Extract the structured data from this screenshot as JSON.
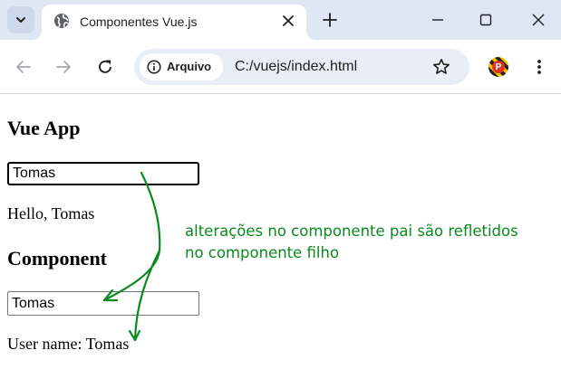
{
  "browser": {
    "tab": {
      "title": "Componentes Vue.js"
    },
    "address_bar": {
      "site_chip_label": "Arquivo",
      "url": "C:/vuejs/index.html"
    },
    "profile_initial": "P"
  },
  "page": {
    "app_heading": "Vue App",
    "parent_input_value": "Tomas",
    "hello_text": "Hello, Tomas",
    "component_heading": "Component",
    "child_input_value": "Tomas",
    "username_text": "User name: Tomas"
  },
  "annotation": {
    "line1": "alterações no componente pai são refletidos",
    "line2": "no componente filho",
    "color": "#0a8a1f"
  },
  "colors": {
    "tabstrip": "#dfe7f5",
    "omnibox": "#e9eef6"
  }
}
